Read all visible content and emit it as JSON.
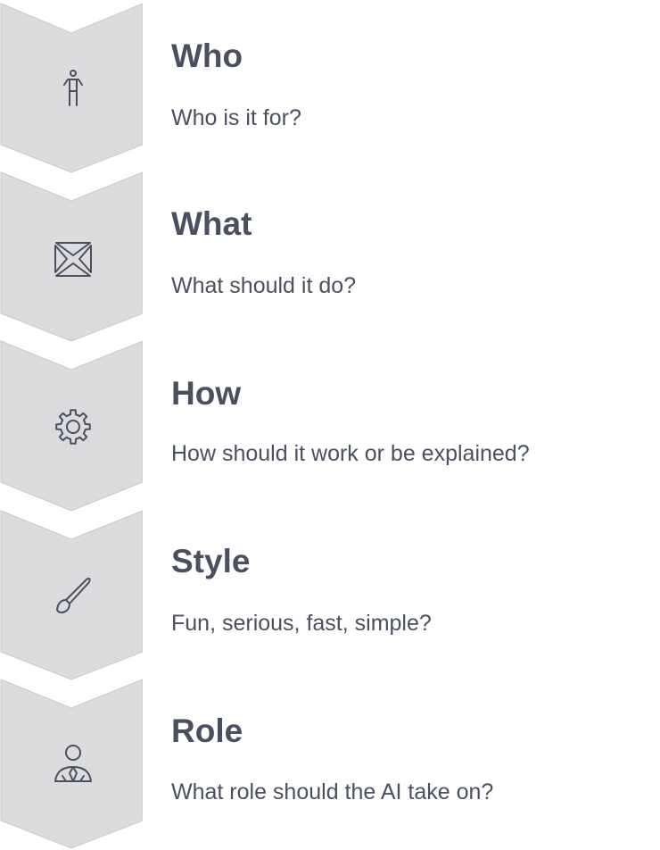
{
  "colors": {
    "chevron_fill": "#dcdcde",
    "chevron_stroke": "#c9c9cc",
    "icon_stroke": "#4b5061",
    "text": "#4b5061"
  },
  "steps": [
    {
      "title": "Who",
      "description": "Who is it for?",
      "icon": "person-icon"
    },
    {
      "title": "What",
      "description": "What should it do?",
      "icon": "collapse-arrows-icon"
    },
    {
      "title": "How",
      "description": "How should it work or be explained?",
      "icon": "gear-icon"
    },
    {
      "title": "Style",
      "description": "Fun, serious, fast, simple?",
      "icon": "paintbrush-icon"
    },
    {
      "title": "Role",
      "description": "What role should the AI take on?",
      "icon": "user-tie-icon"
    }
  ]
}
